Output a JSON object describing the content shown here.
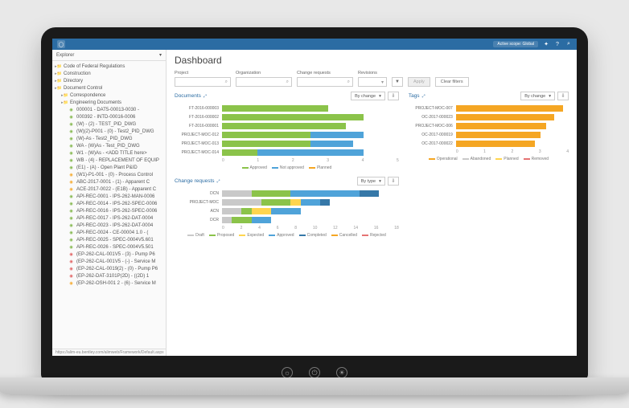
{
  "topbar": {
    "scope": "Active scope: Global"
  },
  "sidebar": {
    "header": "Explorer",
    "status_url": "https://alim-eu.bentley.com/alimweb/Framework/Default.aspx",
    "nodes": [
      {
        "label": "Code of Federal Regulations",
        "icon": "folder",
        "indent": 0
      },
      {
        "label": "Construction",
        "icon": "folder",
        "indent": 0
      },
      {
        "label": "Directory",
        "icon": "folder",
        "indent": 0
      },
      {
        "label": "Document Control",
        "icon": "folder",
        "indent": 0
      },
      {
        "label": "Correspondence",
        "icon": "folder",
        "indent": 1
      },
      {
        "label": "Engineering Documents",
        "icon": "folder",
        "indent": 1
      },
      {
        "label": "000001 - DAT5-00013-0030 -",
        "icon": "doc-green",
        "indent": 2
      },
      {
        "label": "000392 - INTD-00016-0006",
        "icon": "doc-green",
        "indent": 2
      },
      {
        "label": "(W) - (2) - TEST_PID_DWG",
        "icon": "doc-green",
        "indent": 2
      },
      {
        "label": "(W)(2)-P001 - (0) - Test2_PID_DWG",
        "icon": "doc-green",
        "indent": 2
      },
      {
        "label": "(W)-As - Test2_PID_DWG",
        "icon": "doc-green",
        "indent": 2
      },
      {
        "label": "WA - (W)As - Test_PID_DWG",
        "icon": "doc-green",
        "indent": 2
      },
      {
        "label": "W1 - (W)As - <ADD TITLE here>",
        "icon": "doc-green",
        "indent": 2
      },
      {
        "label": "WB - (4) - REPLACEMENT OF EQUIP",
        "icon": "doc-green",
        "indent": 2
      },
      {
        "label": "(E1) - (A) - Open Plant P&ID",
        "icon": "doc-green",
        "indent": 2
      },
      {
        "label": "(W1)-P1-001 - (0) - Process Control",
        "icon": "doc-orange",
        "indent": 2
      },
      {
        "label": "ABC-2017-0001 - (1) - Apparent C",
        "icon": "doc-orange",
        "indent": 2
      },
      {
        "label": "ACE-2017-0022 - (E1B) - Apparent C",
        "icon": "doc-orange",
        "indent": 2
      },
      {
        "label": "API-REC-0001 - IPS-262-MAN-0006",
        "icon": "doc-green",
        "indent": 2
      },
      {
        "label": "API-REC-0014 - IPS-262-SPEC-0006",
        "icon": "doc-green",
        "indent": 2
      },
      {
        "label": "API-REC-0016 - IPS-262-SPEC-0006",
        "icon": "doc-green",
        "indent": 2
      },
      {
        "label": "API-REC-0017 - IPS-262-DAT-0004",
        "icon": "doc-green",
        "indent": 2
      },
      {
        "label": "API-REC-0023 - IPS-262-DAT-0004",
        "icon": "doc-green",
        "indent": 2
      },
      {
        "label": "API-REC-0024 - CE-00004 1.0 - (",
        "icon": "doc-green",
        "indent": 2
      },
      {
        "label": "API-REC-0025 - SPEC-0004V5.601",
        "icon": "doc-green",
        "indent": 2
      },
      {
        "label": "API-REC-0026 - SPEC-0004V5.501",
        "icon": "doc-green",
        "indent": 2
      },
      {
        "label": "(EP-262-CAL-001V5 - (3) - Pump P6",
        "icon": "doc-red",
        "indent": 2
      },
      {
        "label": "(EP-262-CAL-001V5 - (-) - Service M",
        "icon": "doc-red",
        "indent": 2
      },
      {
        "label": "(EP-262-CAL-0019(2) - (0) - Pump P6",
        "icon": "doc-red",
        "indent": 2
      },
      {
        "label": "(EP-262-DAT-3101P(2D) - ((2D) 1",
        "icon": "doc-red",
        "indent": 2
      },
      {
        "label": "(EP-262-OSH-001 2 - (6) - Service M",
        "icon": "doc-orange",
        "indent": 2
      }
    ]
  },
  "page": {
    "title": "Dashboard"
  },
  "filters": {
    "project": "Project",
    "organization": "Organization",
    "change_requests": "Change requests",
    "revisions": "Revisions",
    "apply": "Apply",
    "clear": "Clear filters"
  },
  "documents_panel": {
    "title": "Documents",
    "mode": "By change",
    "legend": [
      "Approved",
      "Not approved",
      "Planned"
    ]
  },
  "tags_panel": {
    "title": "Tags",
    "mode": "By change",
    "legend": [
      "Operational",
      "Abandoned",
      "Planned",
      "Removed"
    ]
  },
  "cr_panel": {
    "title": "Change requests",
    "mode": "By type",
    "legend": [
      "Draft",
      "Proposed",
      "Expected",
      "Approved",
      "Completed",
      "Cancelled",
      "Rejected"
    ]
  },
  "chart_data": [
    {
      "id": "documents",
      "type": "bar",
      "orientation": "horizontal",
      "stacked": true,
      "categories": [
        "FT-2016-000003",
        "FT-2016-000002",
        "FT-2016-000001",
        "PROJECT-MOC-012",
        "PROJECT-MOC-013",
        "PROJECT-MOC-014"
      ],
      "series": [
        {
          "name": "Approved",
          "color": "#8bc34a",
          "values": [
            3.0,
            4.0,
            3.5,
            2.5,
            2.5,
            1.0
          ]
        },
        {
          "name": "Not approved",
          "color": "#4fa3d9",
          "values": [
            0,
            0,
            0,
            1.5,
            1.2,
            3.0
          ]
        },
        {
          "name": "Planned",
          "color": "#f5a623",
          "values": [
            0,
            0,
            0,
            0,
            0,
            0
          ]
        }
      ],
      "xlim": [
        0,
        5
      ],
      "xticks": [
        0,
        1,
        2,
        3,
        4,
        5
      ]
    },
    {
      "id": "tags",
      "type": "bar",
      "orientation": "horizontal",
      "stacked": true,
      "categories": [
        "PROJECT-MOC-007",
        "OC-2017-000023",
        "PROJECT-MOC-006",
        "OC-2017-000019",
        "OC-2017-000022"
      ],
      "series": [
        {
          "name": "Operational",
          "color": "#f5a623",
          "values": [
            3.8,
            3.5,
            3.2,
            3.0,
            2.8
          ]
        },
        {
          "name": "Abandoned",
          "color": "#c9c9c9",
          "values": [
            0,
            0,
            0,
            0,
            0
          ]
        },
        {
          "name": "Planned",
          "color": "#ffd54f",
          "values": [
            0,
            0,
            0,
            0,
            0
          ]
        },
        {
          "name": "Removed",
          "color": "#e57373",
          "values": [
            0,
            0,
            0,
            0,
            0
          ]
        }
      ],
      "xlim": [
        0,
        4
      ],
      "xticks": [
        0,
        1,
        2,
        3,
        4
      ]
    },
    {
      "id": "change_requests",
      "type": "bar",
      "orientation": "horizontal",
      "stacked": true,
      "categories": [
        "DCN",
        "PROJECT-MOC",
        "ACN",
        "DCR"
      ],
      "series": [
        {
          "name": "Draft",
          "color": "#c9c9c9",
          "values": [
            3,
            4,
            2,
            1
          ]
        },
        {
          "name": "Proposed",
          "color": "#8bc34a",
          "values": [
            4,
            3,
            1,
            2
          ]
        },
        {
          "name": "Expected",
          "color": "#ffd54f",
          "values": [
            0,
            1,
            2,
            0
          ]
        },
        {
          "name": "Approved",
          "color": "#4fa3d9",
          "values": [
            7,
            2,
            3,
            2
          ]
        },
        {
          "name": "Completed",
          "color": "#3678a8",
          "values": [
            2,
            1,
            0,
            0
          ]
        },
        {
          "name": "Cancelled",
          "color": "#f5a623",
          "values": [
            0,
            0,
            0,
            0
          ]
        },
        {
          "name": "Rejected",
          "color": "#e57373",
          "values": [
            0,
            0,
            0,
            0
          ]
        }
      ],
      "xlim": [
        0,
        18
      ],
      "xticks": [
        0,
        2,
        4,
        6,
        8,
        10,
        12,
        14,
        16,
        18
      ]
    }
  ]
}
